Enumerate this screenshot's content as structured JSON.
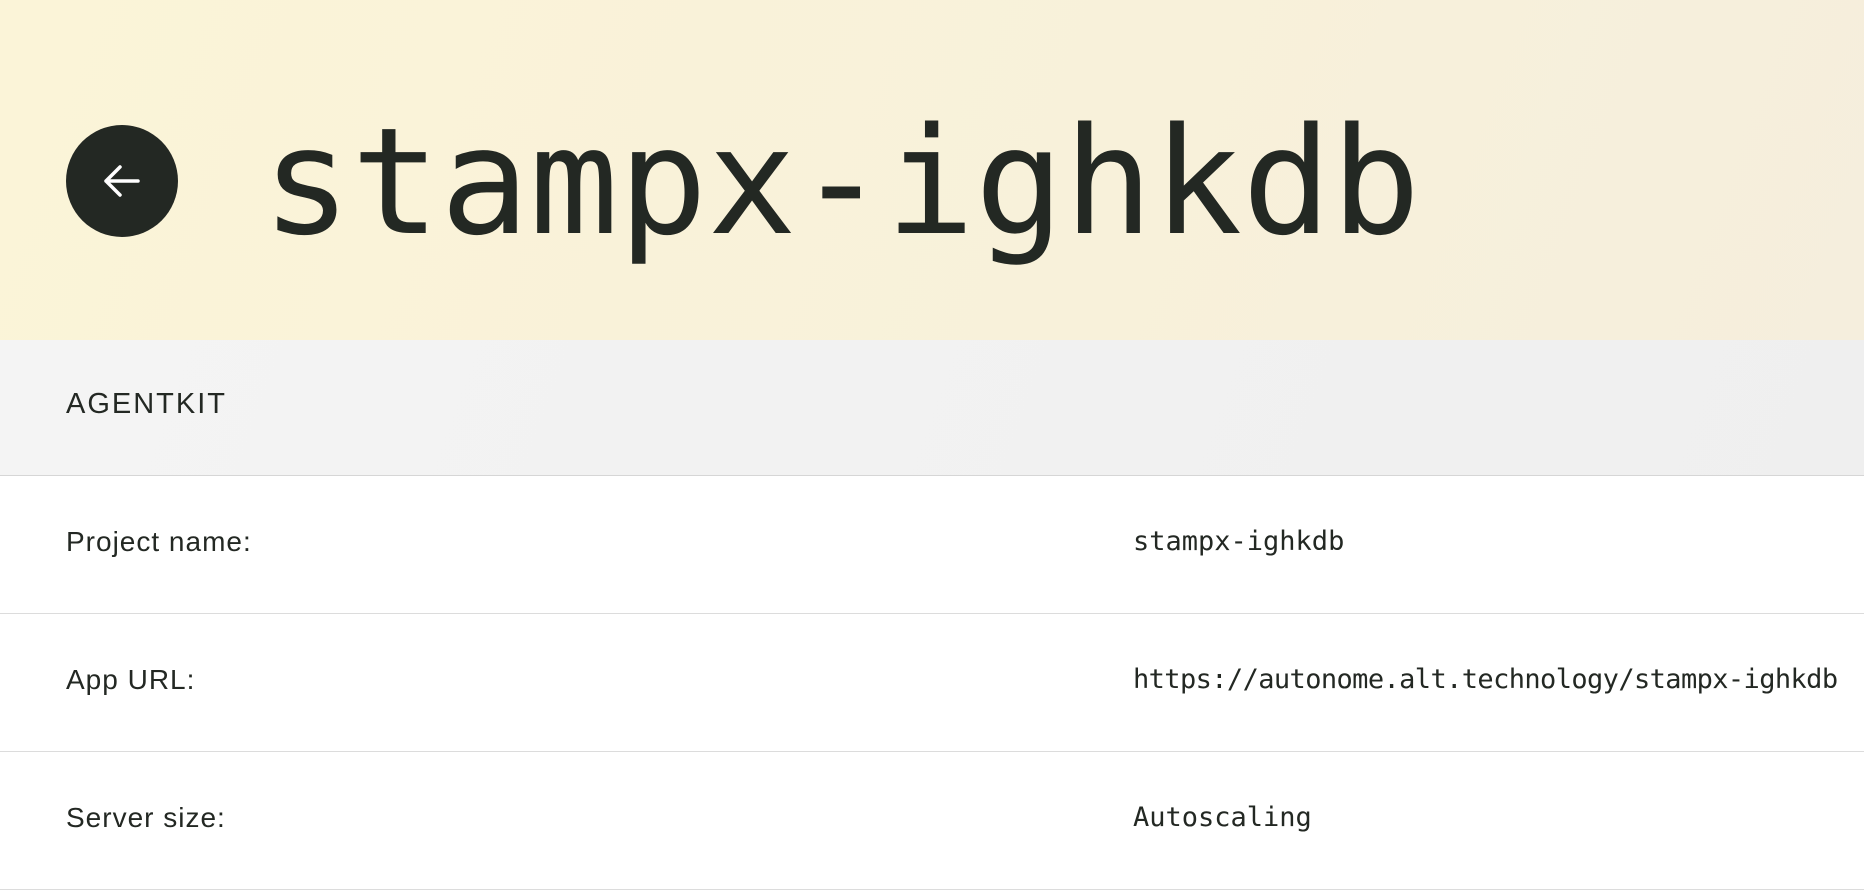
{
  "header": {
    "title": "stampx-ighkdb",
    "back_icon": "arrow-left-icon",
    "background_color": "#fbf4d8",
    "accent_color": "#232823"
  },
  "section": {
    "label": "AGENTKIT"
  },
  "details": [
    {
      "label": "Project name:",
      "value": "stampx-ighkdb"
    },
    {
      "label": "App URL:",
      "value": "https://autonome.alt.technology/stampx-ighkdb"
    },
    {
      "label": "Server size:",
      "value": "Autoscaling"
    }
  ]
}
